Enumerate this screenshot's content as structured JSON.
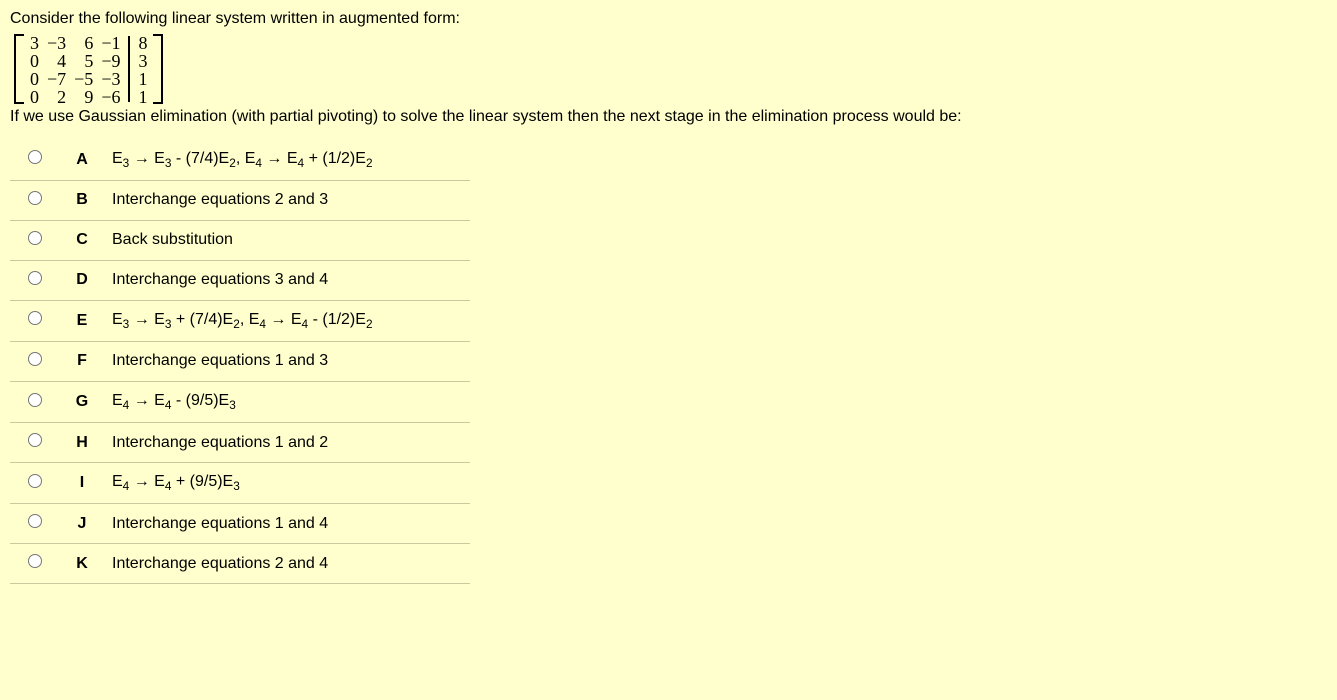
{
  "question": {
    "intro": "Consider the following linear system written in augmented form:",
    "followup": "If we use Gaussian elimination (with partial pivoting) to solve the linear system then the next stage in the elimination process would be:"
  },
  "chart_data": {
    "type": "table",
    "description": "Augmented coefficient matrix [A | b]",
    "A": [
      [
        3,
        -3,
        6,
        -1
      ],
      [
        0,
        4,
        5,
        -9
      ],
      [
        0,
        -7,
        -5,
        -3
      ],
      [
        0,
        2,
        9,
        -6
      ]
    ],
    "b": [
      8,
      3,
      1,
      1
    ]
  },
  "matrix_display": {
    "c1": {
      "r1": "3",
      "r2": "0",
      "r3": "0",
      "r4": "0"
    },
    "c2": {
      "r1": "−3",
      "r2": "4",
      "r3": "−7",
      "r4": "2"
    },
    "c3": {
      "r1": "6",
      "r2": "5",
      "r3": "−5",
      "r4": "9"
    },
    "c4": {
      "r1": "−1",
      "r2": "−9",
      "r3": "−3",
      "r4": "−6"
    },
    "c5": {
      "r1": "8",
      "r2": "3",
      "r3": "1",
      "r4": "1"
    }
  },
  "options": [
    {
      "letter": "A",
      "html": "E<sub>3</sub> → E<sub>3</sub> - (7/4)E<sub>2</sub>, E<sub>4</sub> → E<sub>4</sub> + (1/2)E<sub>2</sub>"
    },
    {
      "letter": "B",
      "html": "Interchange equations 2 and 3"
    },
    {
      "letter": "C",
      "html": "Back substitution"
    },
    {
      "letter": "D",
      "html": "Interchange equations 3 and 4"
    },
    {
      "letter": "E",
      "html": "E<sub>3</sub> → E<sub>3</sub> + (7/4)E<sub>2</sub>, E<sub>4</sub> → E<sub>4</sub> - (1/2)E<sub>2</sub>"
    },
    {
      "letter": "F",
      "html": "Interchange equations 1 and 3"
    },
    {
      "letter": "G",
      "html": "E<sub>4</sub> → E<sub>4</sub> - (9/5)E<sub>3</sub>"
    },
    {
      "letter": "H",
      "html": "Interchange equations 1 and 2"
    },
    {
      "letter": "I",
      "html": "E<sub>4</sub> → E<sub>4</sub> + (9/5)E<sub>3</sub>"
    },
    {
      "letter": "J",
      "html": "Interchange equations 1 and 4"
    },
    {
      "letter": "K",
      "html": "Interchange equations 2 and 4"
    }
  ]
}
